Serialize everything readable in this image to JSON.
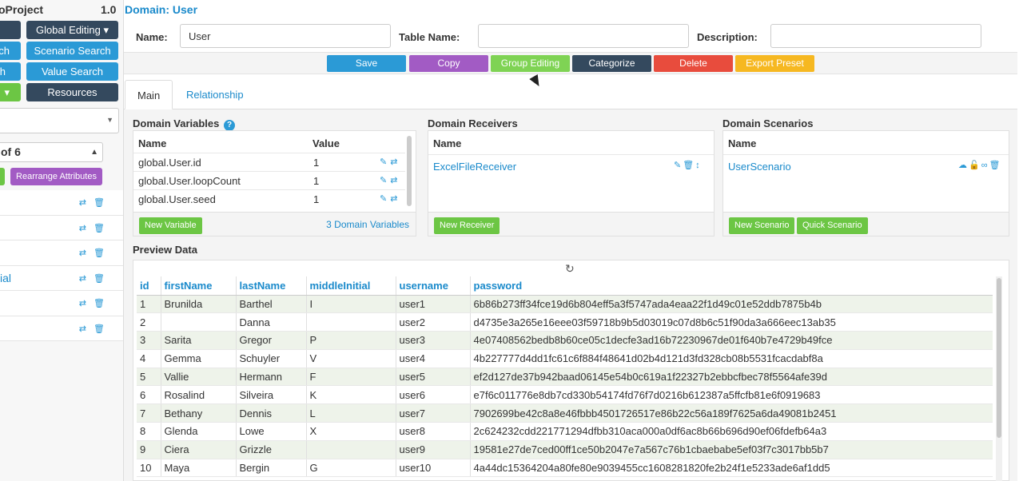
{
  "sidebar": {
    "title": "oProject",
    "version": "1.0",
    "buttons": {
      "global_editing": "Global Editing ▾",
      "scenario_search": "Scenario Search",
      "value_search": "Value Search",
      "resources": "Resources",
      "left_dark": "",
      "left_blue_1": "ch",
      "left_blue_2": "h",
      "left_green": "▾"
    },
    "paging": "of 6",
    "rearrange": "Rearrange Attributes",
    "items": [
      {
        "label": ""
      },
      {
        "label": ""
      },
      {
        "label": ""
      },
      {
        "label": "ial"
      },
      {
        "label": ""
      },
      {
        "label": ""
      }
    ]
  },
  "domain": {
    "title": "Domain: User",
    "name_label": "Name:",
    "name_value": "User",
    "table_name_label": "Table Name:",
    "table_name_value": "",
    "description_label": "Description:",
    "description_value": ""
  },
  "actions": {
    "save": "Save",
    "copy": "Copy",
    "group_editing": "Group Editing",
    "categorize": "Categorize",
    "delete": "Delete",
    "export_preset": "Export Preset"
  },
  "tabs": {
    "main": "Main",
    "relationship": "Relationship"
  },
  "variables": {
    "title": "Domain Variables",
    "col_name": "Name",
    "col_value": "Value",
    "rows": [
      {
        "name": "global.User.id",
        "value": "1"
      },
      {
        "name": "global.User.loopCount",
        "value": "1"
      },
      {
        "name": "global.User.seed",
        "value": "1"
      }
    ],
    "new_button": "New Variable",
    "count_link": "3 Domain Variables"
  },
  "receivers": {
    "title": "Domain Receivers",
    "col_name": "Name",
    "item": "ExcelFileReceiver",
    "new_button": "New Receiver"
  },
  "scenarios": {
    "title": "Domain Scenarios",
    "col_name": "Name",
    "item": "UserScenario",
    "new_button": "New Scenario",
    "quick_button": "Quick Scenario"
  },
  "preview": {
    "title": "Preview Data",
    "columns": [
      "id",
      "firstName",
      "lastName",
      "middleInitial",
      "username",
      "password"
    ],
    "rows": [
      [
        "1",
        "Brunilda",
        "Barthel",
        "I",
        "user1",
        "6b86b273ff34fce19d6b804eff5a3f5747ada4eaa22f1d49c01e52ddb7875b4b"
      ],
      [
        "2",
        "",
        "Danna",
        "",
        "user2",
        "d4735e3a265e16eee03f59718b9b5d03019c07d8b6c51f90da3a666eec13ab35"
      ],
      [
        "3",
        "Sarita",
        "Gregor",
        "P",
        "user3",
        "4e07408562bedb8b60ce05c1decfe3ad16b72230967de01f640b7e4729b49fce"
      ],
      [
        "4",
        "Gemma",
        "Schuyler",
        "V",
        "user4",
        "4b227777d4dd1fc61c6f884f48641d02b4d121d3fd328cb08b5531fcacdabf8a"
      ],
      [
        "5",
        "Vallie",
        "Hermann",
        "F",
        "user5",
        "ef2d127de37b942baad06145e54b0c619a1f22327b2ebbcfbec78f5564afe39d"
      ],
      [
        "6",
        "Rosalind",
        "Silveira",
        "K",
        "user6",
        "e7f6c011776e8db7cd330b54174fd76f7d0216b612387a5ffcfb81e6f0919683"
      ],
      [
        "7",
        "Bethany",
        "Dennis",
        "L",
        "user7",
        "7902699be42c8a8e46fbbb4501726517e86b22c56a189f7625a6da49081b2451"
      ],
      [
        "8",
        "Glenda",
        "Lowe",
        "X",
        "user8",
        "2c624232cdd221771294dfbb310aca000a0df6ac8b66b696d90ef06fdefb64a3"
      ],
      [
        "9",
        "Ciera",
        "Grizzle",
        "",
        "user9",
        "19581e27de7ced00ff1ce50b2047e7a567c76b1cbaebabe5ef03f7c3017bb5b7"
      ],
      [
        "10",
        "Maya",
        "Bergin",
        "G",
        "user10",
        "4a44dc15364204a80fe80e9039455cc1608281820fe2b24f1e5233ade6af1dd5"
      ]
    ]
  },
  "icons": {
    "edit": "✎",
    "swap": "⇄",
    "trash": "🗑",
    "refresh": "↻",
    "help": "?",
    "cloud": "☁",
    "unlock": "🔓",
    "link": "∞",
    "sort": "↕"
  }
}
